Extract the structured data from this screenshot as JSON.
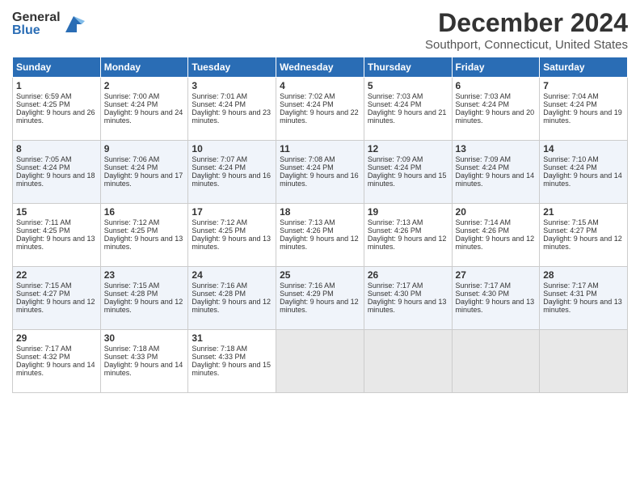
{
  "header": {
    "logo_general": "General",
    "logo_blue": "Blue",
    "main_title": "December 2024",
    "subtitle": "Southport, Connecticut, United States"
  },
  "weekdays": [
    "Sunday",
    "Monday",
    "Tuesday",
    "Wednesday",
    "Thursday",
    "Friday",
    "Saturday"
  ],
  "weeks": [
    [
      {
        "num": "1",
        "rise": "6:59 AM",
        "set": "4:25 PM",
        "hours": "9 hours and 26 minutes."
      },
      {
        "num": "2",
        "rise": "7:00 AM",
        "set": "4:24 PM",
        "hours": "9 hours and 24 minutes."
      },
      {
        "num": "3",
        "rise": "7:01 AM",
        "set": "4:24 PM",
        "hours": "9 hours and 23 minutes."
      },
      {
        "num": "4",
        "rise": "7:02 AM",
        "set": "4:24 PM",
        "hours": "9 hours and 22 minutes."
      },
      {
        "num": "5",
        "rise": "7:03 AM",
        "set": "4:24 PM",
        "hours": "9 hours and 21 minutes."
      },
      {
        "num": "6",
        "rise": "7:03 AM",
        "set": "4:24 PM",
        "hours": "9 hours and 20 minutes."
      },
      {
        "num": "7",
        "rise": "7:04 AM",
        "set": "4:24 PM",
        "hours": "9 hours and 19 minutes."
      }
    ],
    [
      {
        "num": "8",
        "rise": "7:05 AM",
        "set": "4:24 PM",
        "hours": "9 hours and 18 minutes."
      },
      {
        "num": "9",
        "rise": "7:06 AM",
        "set": "4:24 PM",
        "hours": "9 hours and 17 minutes."
      },
      {
        "num": "10",
        "rise": "7:07 AM",
        "set": "4:24 PM",
        "hours": "9 hours and 16 minutes."
      },
      {
        "num": "11",
        "rise": "7:08 AM",
        "set": "4:24 PM",
        "hours": "9 hours and 16 minutes."
      },
      {
        "num": "12",
        "rise": "7:09 AM",
        "set": "4:24 PM",
        "hours": "9 hours and 15 minutes."
      },
      {
        "num": "13",
        "rise": "7:09 AM",
        "set": "4:24 PM",
        "hours": "9 hours and 14 minutes."
      },
      {
        "num": "14",
        "rise": "7:10 AM",
        "set": "4:24 PM",
        "hours": "9 hours and 14 minutes."
      }
    ],
    [
      {
        "num": "15",
        "rise": "7:11 AM",
        "set": "4:25 PM",
        "hours": "9 hours and 13 minutes."
      },
      {
        "num": "16",
        "rise": "7:12 AM",
        "set": "4:25 PM",
        "hours": "9 hours and 13 minutes."
      },
      {
        "num": "17",
        "rise": "7:12 AM",
        "set": "4:25 PM",
        "hours": "9 hours and 13 minutes."
      },
      {
        "num": "18",
        "rise": "7:13 AM",
        "set": "4:26 PM",
        "hours": "9 hours and 12 minutes."
      },
      {
        "num": "19",
        "rise": "7:13 AM",
        "set": "4:26 PM",
        "hours": "9 hours and 12 minutes."
      },
      {
        "num": "20",
        "rise": "7:14 AM",
        "set": "4:26 PM",
        "hours": "9 hours and 12 minutes."
      },
      {
        "num": "21",
        "rise": "7:15 AM",
        "set": "4:27 PM",
        "hours": "9 hours and 12 minutes."
      }
    ],
    [
      {
        "num": "22",
        "rise": "7:15 AM",
        "set": "4:27 PM",
        "hours": "9 hours and 12 minutes."
      },
      {
        "num": "23",
        "rise": "7:15 AM",
        "set": "4:28 PM",
        "hours": "9 hours and 12 minutes."
      },
      {
        "num": "24",
        "rise": "7:16 AM",
        "set": "4:28 PM",
        "hours": "9 hours and 12 minutes."
      },
      {
        "num": "25",
        "rise": "7:16 AM",
        "set": "4:29 PM",
        "hours": "9 hours and 12 minutes."
      },
      {
        "num": "26",
        "rise": "7:17 AM",
        "set": "4:30 PM",
        "hours": "9 hours and 13 minutes."
      },
      {
        "num": "27",
        "rise": "7:17 AM",
        "set": "4:30 PM",
        "hours": "9 hours and 13 minutes."
      },
      {
        "num": "28",
        "rise": "7:17 AM",
        "set": "4:31 PM",
        "hours": "9 hours and 13 minutes."
      }
    ],
    [
      {
        "num": "29",
        "rise": "7:17 AM",
        "set": "4:32 PM",
        "hours": "9 hours and 14 minutes."
      },
      {
        "num": "30",
        "rise": "7:18 AM",
        "set": "4:33 PM",
        "hours": "9 hours and 14 minutes."
      },
      {
        "num": "31",
        "rise": "7:18 AM",
        "set": "4:33 PM",
        "hours": "9 hours and 15 minutes."
      },
      null,
      null,
      null,
      null
    ]
  ],
  "labels": {
    "sunrise": "Sunrise:",
    "sunset": "Sunset:",
    "daylight": "Daylight:"
  }
}
